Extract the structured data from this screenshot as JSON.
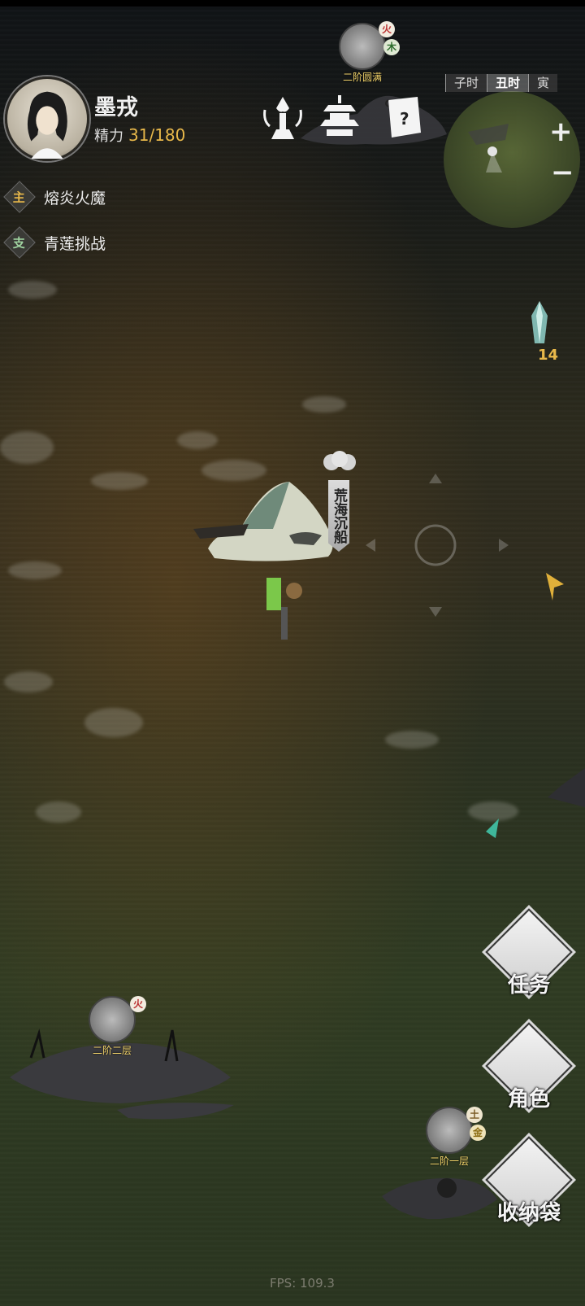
{
  "player": {
    "name": "墨戎",
    "energy_label": "精力",
    "energy_value": "31/180"
  },
  "quests": [
    {
      "tag": "主",
      "tag_color": "#e8b84a",
      "label": "熔炎火魔"
    },
    {
      "tag": "支",
      "tag_color": "#9fd3a0",
      "label": "青莲挑战"
    }
  ],
  "timebar": [
    "子时",
    "丑时",
    "寅"
  ],
  "zoom": {
    "plus": "+",
    "minus": "−"
  },
  "enemies": [
    {
      "rank": "二阶圆满",
      "elements": [
        "火",
        "木"
      ]
    },
    {
      "rank": "二阶二层",
      "elements": [
        "火"
      ]
    },
    {
      "rank": "二阶一层",
      "elements": [
        "土",
        "金"
      ]
    }
  ],
  "location_banner": "荒海沉船",
  "item_counter": "14",
  "side_buttons": {
    "tasks": "任务",
    "character": "角色",
    "bag": "收纳袋"
  },
  "fps": "FPS: 109.3"
}
